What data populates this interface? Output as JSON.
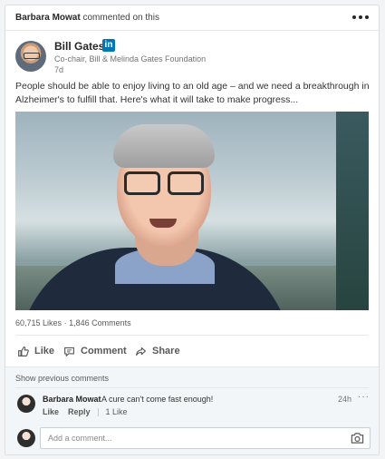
{
  "header": {
    "commenter_name": "Barbara Mowat",
    "commented_label": "commented on this",
    "more_icon": "more-horizontal-icon"
  },
  "post": {
    "author": {
      "name": "Bill Gates",
      "badge": "in",
      "headline": "Co-chair, Bill & Melinda Gates Foundation",
      "time": "7d"
    },
    "text": "People should be able to enjoy living to an old age – and we need a breakthrough in Alzheimer's to fulfill that. Here's what it will take to make progress...",
    "stats": {
      "likes": "60,715 Likes",
      "separator": "·",
      "comments": "1,846 Comments"
    }
  },
  "actions": {
    "like": "Like",
    "comment": "Comment",
    "share": "Share"
  },
  "comments": {
    "show_previous": "Show previous comments",
    "items": [
      {
        "author": "Barbara Mowat",
        "text": "A cure can't come fast enough!",
        "time": "24h",
        "like_label": "Like",
        "reply_label": "Reply",
        "like_count": "1 Like"
      }
    ],
    "input": {
      "placeholder": "Add a comment..."
    }
  },
  "colors": {
    "linkedin_blue": "#0077b5",
    "text_dark": "#262626",
    "muted": "#737373",
    "comment_bg": "#f3f6f8"
  }
}
